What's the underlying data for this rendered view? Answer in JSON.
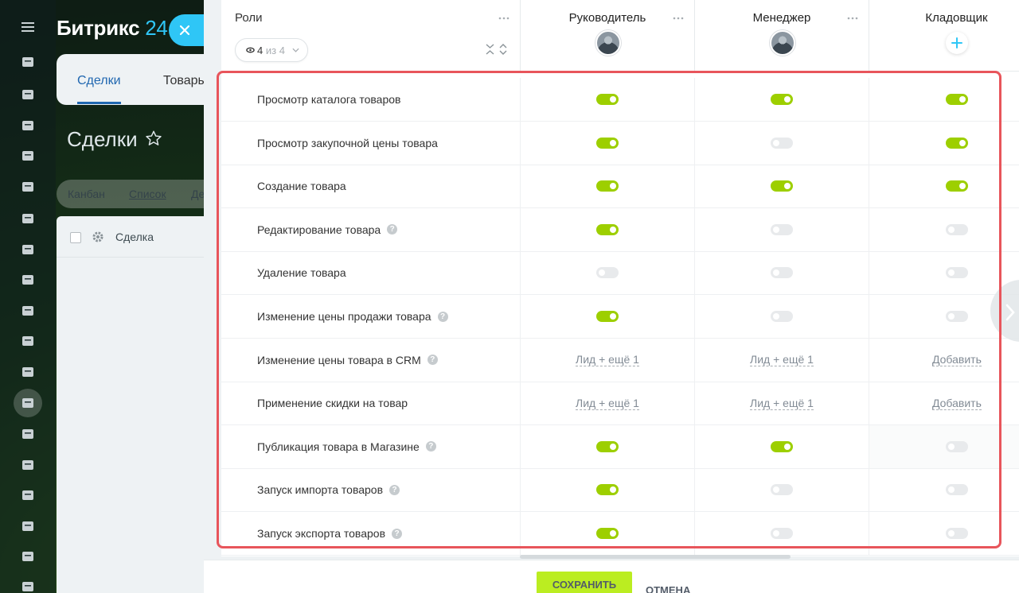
{
  "background": {
    "brand_name": "Битрикс",
    "brand_number": "24",
    "tabs": [
      "Сделки",
      "Товары"
    ],
    "page_title": "Сделки",
    "views": [
      "Канбан",
      "Список",
      "Де"
    ],
    "grid_column": "Сделка",
    "rail_icons": [
      "activity-icon",
      "feed-icon",
      "chat-icon",
      "hexagon-icon",
      "calendar-icon",
      "document-icon",
      "presentation-icon",
      "drive-icon",
      "mail-icon",
      "group-icon",
      "tasks-icon",
      "crm-funnel-icon",
      "planner-icon",
      "store-icon",
      "target-icon",
      "shop-cart-icon",
      "edit-doc-icon",
      "pencil-icon"
    ],
    "brand_color": "#2fc6f6"
  },
  "table": {
    "roles_title": "Роли",
    "filter_count": "4",
    "filter_of": "из 4",
    "roles": [
      {
        "name": "Руководитель",
        "has_avatar": true
      },
      {
        "name": "Менеджер",
        "has_avatar": true
      },
      {
        "name": "Кладовщик",
        "has_avatar": false
      }
    ],
    "rows": [
      {
        "label": "Просмотр каталога товаров",
        "help": false,
        "values": [
          "on",
          "on",
          "on"
        ]
      },
      {
        "label": "Просмотр закупочной цены товара",
        "help": false,
        "values": [
          "on",
          "off",
          "on"
        ]
      },
      {
        "label": "Создание товара",
        "help": false,
        "values": [
          "on",
          "on",
          "on"
        ]
      },
      {
        "label": "Редактирование товара",
        "help": true,
        "values": [
          "on",
          "off",
          "off"
        ]
      },
      {
        "label": "Удаление товара",
        "help": false,
        "values": [
          "off",
          "off",
          "off"
        ]
      },
      {
        "label": "Изменение цены продажи товара",
        "help": true,
        "values": [
          "on",
          "off",
          "off"
        ]
      },
      {
        "label": "Изменение цены товара в CRM",
        "help": true,
        "values": [
          "Лид + ещё 1",
          "Лид + ещё 1",
          "Добавить"
        ]
      },
      {
        "label": "Применение скидки на товар",
        "help": false,
        "values": [
          "Лид + ещё 1",
          "Лид + ещё 1",
          "Добавить"
        ]
      },
      {
        "label": "Публикация товара в Магазине",
        "help": true,
        "values": [
          "on",
          "on",
          "off"
        ]
      },
      {
        "label": "Запуск импорта товаров",
        "help": true,
        "values": [
          "on",
          "off",
          "off"
        ]
      },
      {
        "label": "Запуск экспорта товаров",
        "help": true,
        "values": [
          "on",
          "off",
          "off"
        ]
      }
    ]
  },
  "footer": {
    "save_label": "СОХРАНИТЬ",
    "cancel_label": "ОТМЕНА"
  },
  "colors": {
    "toggle_on": "#9dcf00",
    "toggle_off": "#e8eaec",
    "highlight": "#e8555b",
    "save_button": "#bbed21"
  }
}
